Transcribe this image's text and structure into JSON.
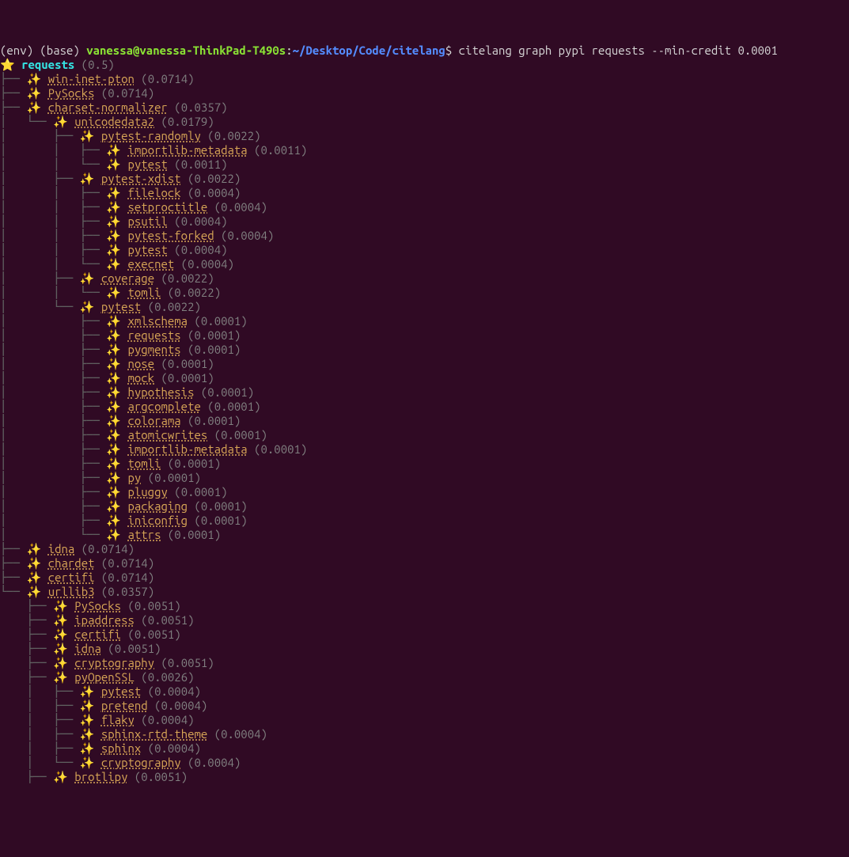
{
  "prompt": {
    "env": "(env) (base) ",
    "user": "vanessa@vanessa-ThinkPad-T490s",
    "colon": ":",
    "path": "~/Desktop/Code/citelang",
    "dollar": "$ ",
    "cmd": "citelang graph pypi requests --min-credit 0.0001"
  },
  "root": {
    "star": "⭐️ ",
    "name": "requests",
    "value": " (0.5)"
  },
  "lines": [
    {
      "pre": "├── ",
      "s": "✨️ ",
      "name": "win-inet-pton",
      "val": " (0.0714)"
    },
    {
      "pre": "├── ",
      "s": "✨️ ",
      "name": "PySocks",
      "val": " (0.0714)"
    },
    {
      "pre": "├── ",
      "s": "✨️ ",
      "name": "charset-normalizer",
      "val": " (0.0357)"
    },
    {
      "pre": "│   └── ",
      "s": "✨️ ",
      "name": "unicodedata2",
      "val": " (0.0179)"
    },
    {
      "pre": "│       ├── ",
      "s": "✨️ ",
      "name": "pytest-randomly",
      "val": " (0.0022)"
    },
    {
      "pre": "│       │   ├── ",
      "s": "✨️ ",
      "name": "importlib-metadata",
      "val": " (0.0011)"
    },
    {
      "pre": "│       │   └── ",
      "s": "✨️ ",
      "name": "pytest",
      "val": " (0.0011)"
    },
    {
      "pre": "│       ├── ",
      "s": "✨️ ",
      "name": "pytest-xdist",
      "val": " (0.0022)"
    },
    {
      "pre": "│       │   ├── ",
      "s": "✨️ ",
      "name": "filelock",
      "val": " (0.0004)"
    },
    {
      "pre": "│       │   ├── ",
      "s": "✨️ ",
      "name": "setproctitle",
      "val": " (0.0004)"
    },
    {
      "pre": "│       │   ├── ",
      "s": "✨️ ",
      "name": "psutil",
      "val": " (0.0004)"
    },
    {
      "pre": "│       │   ├── ",
      "s": "✨️ ",
      "name": "pytest-forked",
      "val": " (0.0004)"
    },
    {
      "pre": "│       │   ├── ",
      "s": "✨️ ",
      "name": "pytest",
      "val": " (0.0004)"
    },
    {
      "pre": "│       │   └── ",
      "s": "✨️ ",
      "name": "execnet",
      "val": " (0.0004)"
    },
    {
      "pre": "│       ├── ",
      "s": "✨️ ",
      "name": "coverage",
      "val": " (0.0022)"
    },
    {
      "pre": "│       │   └── ",
      "s": "✨️ ",
      "name": "tomli",
      "val": " (0.0022)"
    },
    {
      "pre": "│       └── ",
      "s": "✨️ ",
      "name": "pytest",
      "val": " (0.0022)"
    },
    {
      "pre": "│           ├── ",
      "s": "✨️ ",
      "name": "xmlschema",
      "val": " (0.0001)"
    },
    {
      "pre": "│           ├── ",
      "s": "✨️ ",
      "name": "requests",
      "val": " (0.0001)"
    },
    {
      "pre": "│           ├── ",
      "s": "✨️ ",
      "name": "pygments",
      "val": " (0.0001)"
    },
    {
      "pre": "│           ├── ",
      "s": "✨️ ",
      "name": "nose",
      "val": " (0.0001)"
    },
    {
      "pre": "│           ├── ",
      "s": "✨️ ",
      "name": "mock",
      "val": " (0.0001)"
    },
    {
      "pre": "│           ├── ",
      "s": "✨️ ",
      "name": "hypothesis",
      "val": " (0.0001)"
    },
    {
      "pre": "│           ├── ",
      "s": "✨️ ",
      "name": "argcomplete",
      "val": " (0.0001)"
    },
    {
      "pre": "│           ├── ",
      "s": "✨️ ",
      "name": "colorama",
      "val": " (0.0001)"
    },
    {
      "pre": "│           ├── ",
      "s": "✨️ ",
      "name": "atomicwrites",
      "val": " (0.0001)"
    },
    {
      "pre": "│           ├── ",
      "s": "✨️ ",
      "name": "importlib-metadata",
      "val": " (0.0001)"
    },
    {
      "pre": "│           ├── ",
      "s": "✨️ ",
      "name": "tomli",
      "val": " (0.0001)"
    },
    {
      "pre": "│           ├── ",
      "s": "✨️ ",
      "name": "py",
      "val": " (0.0001)"
    },
    {
      "pre": "│           ├── ",
      "s": "✨️ ",
      "name": "pluggy",
      "val": " (0.0001)"
    },
    {
      "pre": "│           ├── ",
      "s": "✨️ ",
      "name": "packaging",
      "val": " (0.0001)"
    },
    {
      "pre": "│           ├── ",
      "s": "✨️ ",
      "name": "iniconfig",
      "val": " (0.0001)"
    },
    {
      "pre": "│           └── ",
      "s": "✨️ ",
      "name": "attrs",
      "val": " (0.0001)"
    },
    {
      "pre": "├── ",
      "s": "✨️ ",
      "name": "idna",
      "val": " (0.0714)"
    },
    {
      "pre": "├── ",
      "s": "✨️ ",
      "name": "chardet",
      "val": " (0.0714)"
    },
    {
      "pre": "├── ",
      "s": "✨️ ",
      "name": "certifi",
      "val": " (0.0714)"
    },
    {
      "pre": "└── ",
      "s": "✨️ ",
      "name": "urllib3",
      "val": " (0.0357)"
    },
    {
      "pre": "    ├── ",
      "s": "✨️ ",
      "name": "PySocks",
      "val": " (0.0051)"
    },
    {
      "pre": "    ├── ",
      "s": "✨️ ",
      "name": "ipaddress",
      "val": " (0.0051)"
    },
    {
      "pre": "    ├── ",
      "s": "✨️ ",
      "name": "certifi",
      "val": " (0.0051)"
    },
    {
      "pre": "    ├── ",
      "s": "✨️ ",
      "name": "idna",
      "val": " (0.0051)"
    },
    {
      "pre": "    ├── ",
      "s": "✨️ ",
      "name": "cryptography",
      "val": " (0.0051)"
    },
    {
      "pre": "    ├── ",
      "s": "✨️ ",
      "name": "pyOpenSSL",
      "val": " (0.0026)"
    },
    {
      "pre": "    │   ├── ",
      "s": "✨️ ",
      "name": "pytest",
      "val": " (0.0004)"
    },
    {
      "pre": "    │   ├── ",
      "s": "✨️ ",
      "name": "pretend",
      "val": " (0.0004)"
    },
    {
      "pre": "    │   ├── ",
      "s": "✨️ ",
      "name": "flaky",
      "val": " (0.0004)"
    },
    {
      "pre": "    │   ├── ",
      "s": "✨️ ",
      "name": "sphinx-rtd-theme",
      "val": " (0.0004)"
    },
    {
      "pre": "    │   ├── ",
      "s": "✨️ ",
      "name": "sphinx",
      "val": " (0.0004)"
    },
    {
      "pre": "    │   └── ",
      "s": "✨️ ",
      "name": "cryptography",
      "val": " (0.0004)"
    },
    {
      "pre": "    ├── ",
      "s": "✨️ ",
      "name": "brotlipy",
      "val": " (0.0051)"
    }
  ]
}
